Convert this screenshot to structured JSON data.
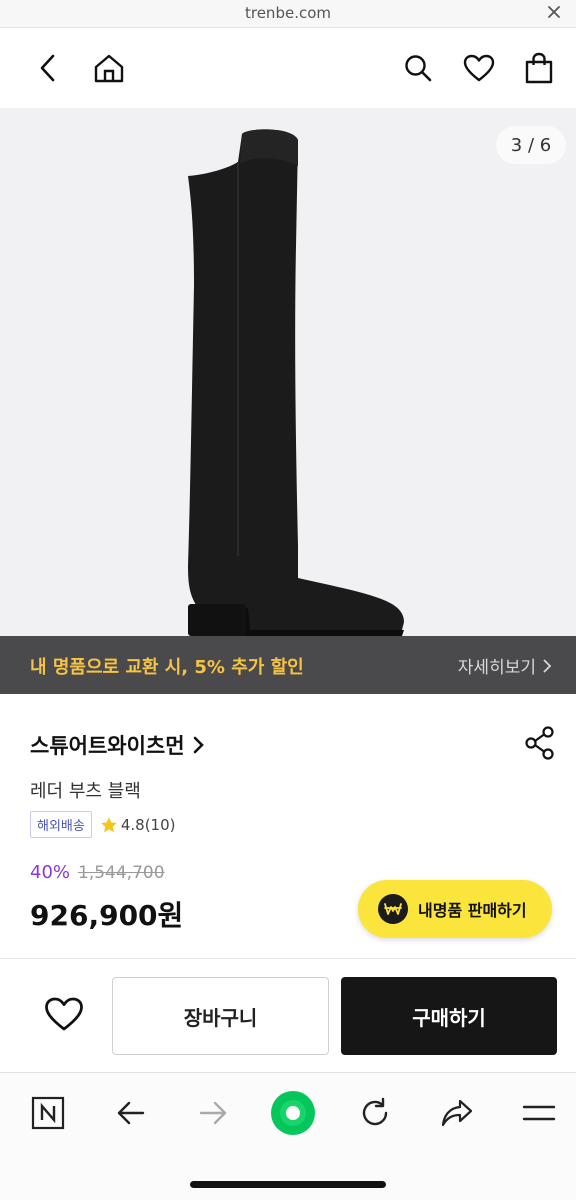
{
  "browser": {
    "url": "trenbe.com"
  },
  "header": {
    "icons": [
      "back-icon",
      "home-icon",
      "search-icon",
      "heart-icon",
      "shopping-bag-icon"
    ]
  },
  "gallery": {
    "counter": "3 / 6"
  },
  "promo": {
    "text": "내 명품으로 교환 시, 5% 추가 할인",
    "more": "자세히보기"
  },
  "product": {
    "brand": "스튜어트와이츠먼",
    "name": "레더 부츠 블랙",
    "shipping_badge": "해외배송",
    "rating": "4.8(10)",
    "discount": "40%",
    "original_price": "1,544,700",
    "price": "926,900원"
  },
  "sell_button": {
    "label": "내명품 판매하기"
  },
  "actions": {
    "cart_label": "장바구니",
    "buy_label": "구매하기"
  },
  "toolbar": {
    "icons": [
      "naver-icon",
      "back-arrow-icon",
      "forward-arrow-icon",
      "green-dot-icon",
      "reload-icon",
      "share-arrow-icon",
      "menu-icon"
    ]
  },
  "colors": {
    "promo_bg": "#4a4a4c",
    "promo_text": "#f6c445",
    "discount": "#8a37d9",
    "sell_button": "#fbe43c",
    "buy_button": "#161616",
    "accent_green": "#03c75a"
  }
}
